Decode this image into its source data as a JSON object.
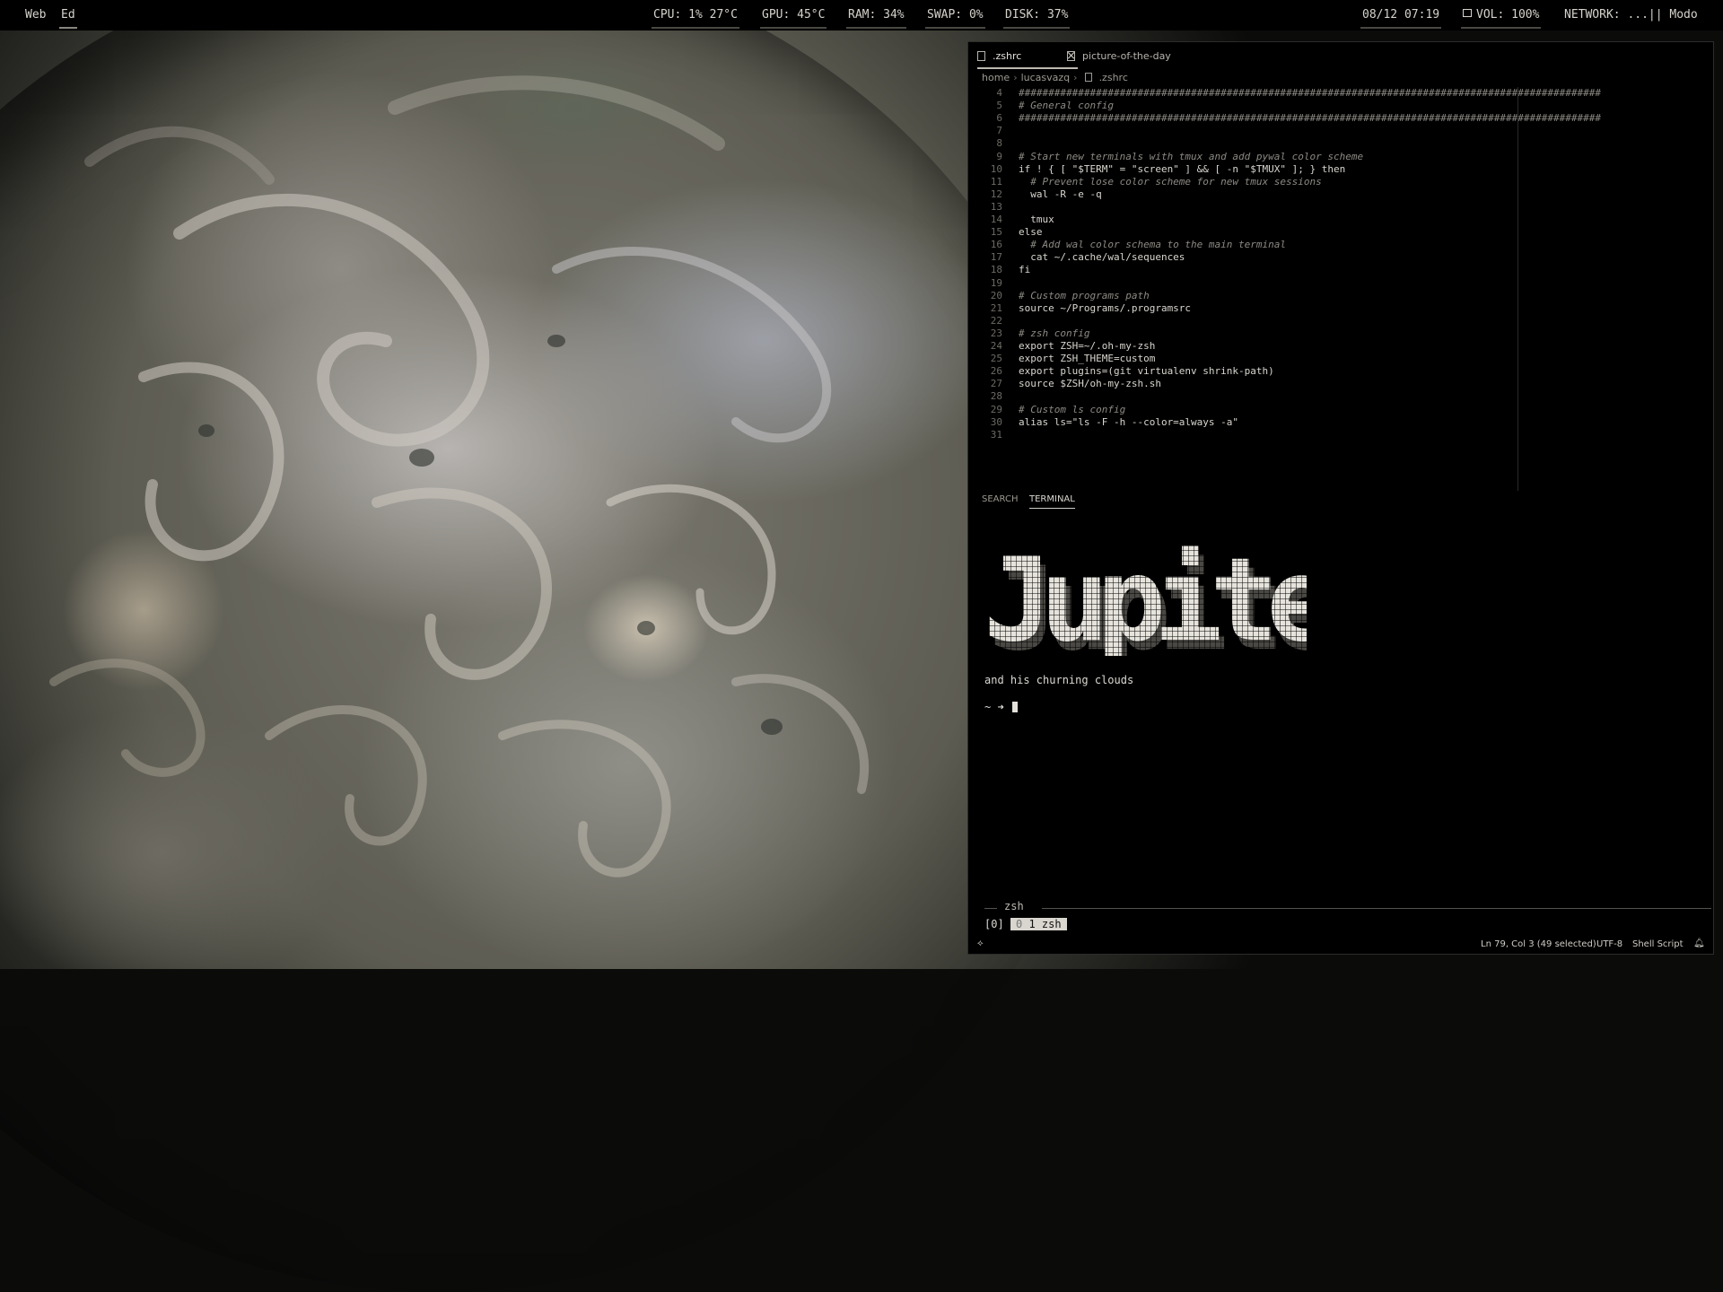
{
  "topbar": {
    "workspaces": [
      {
        "label": "Web",
        "active": false
      },
      {
        "label": "Ed",
        "active": true
      }
    ],
    "cpu": "CPU: 1% 27°C",
    "gpu": "GPU: 45°C",
    "ram": "RAM: 34%",
    "swap": "SWAP: 0%",
    "disk": "DISK: 37%",
    "datetime": "08/12 07:19",
    "volume": "VOL: 100%",
    "network": "NETWORK: ...|| Modo"
  },
  "editor": {
    "tabs": [
      {
        "label": ".zshrc",
        "active": true
      },
      {
        "label": "picture-of-the-day",
        "active": false
      }
    ],
    "breadcrumb": [
      "home",
      "lucasvazq",
      ".zshrc"
    ],
    "code_lines": [
      {
        "n": "4",
        "text": "##################################################################################################",
        "kind": "hash"
      },
      {
        "n": "5",
        "text": "# General config",
        "kind": "comment"
      },
      {
        "n": "6",
        "text": "##################################################################################################",
        "kind": "hash"
      },
      {
        "n": "7",
        "text": "",
        "kind": "code"
      },
      {
        "n": "8",
        "text": "",
        "kind": "code"
      },
      {
        "n": "9",
        "text": "# Start new terminals with tmux and add pywal color scheme",
        "kind": "comment"
      },
      {
        "n": "10",
        "text": "if ! { [ \"$TERM\" = \"screen\" ] && [ -n \"$TMUX\" ]; } then",
        "kind": "code"
      },
      {
        "n": "11",
        "text": "  # Prevent lose color scheme for new tmux sessions",
        "kind": "comment"
      },
      {
        "n": "12",
        "text": "  wal -R -e -q",
        "kind": "code"
      },
      {
        "n": "13",
        "text": "",
        "kind": "code"
      },
      {
        "n": "14",
        "text": "  tmux",
        "kind": "code"
      },
      {
        "n": "15",
        "text": "else",
        "kind": "code"
      },
      {
        "n": "16",
        "text": "  # Add wal color schema to the main terminal",
        "kind": "comment"
      },
      {
        "n": "17",
        "text": "  cat ~/.cache/wal/sequences",
        "kind": "code"
      },
      {
        "n": "18",
        "text": "fi",
        "kind": "code"
      },
      {
        "n": "19",
        "text": "",
        "kind": "code"
      },
      {
        "n": "20",
        "text": "# Custom programs path",
        "kind": "comment"
      },
      {
        "n": "21",
        "text": "source ~/Programs/.programsrc",
        "kind": "code"
      },
      {
        "n": "22",
        "text": "",
        "kind": "code"
      },
      {
        "n": "23",
        "text": "# zsh config",
        "kind": "comment"
      },
      {
        "n": "24",
        "text": "export ZSH=~/.oh-my-zsh",
        "kind": "code"
      },
      {
        "n": "25",
        "text": "export ZSH_THEME=custom",
        "kind": "code"
      },
      {
        "n": "26",
        "text": "export plugins=(git virtualenv shrink-path)",
        "kind": "code"
      },
      {
        "n": "27",
        "text": "source $ZSH/oh-my-zsh.sh",
        "kind": "code"
      },
      {
        "n": "28",
        "text": "",
        "kind": "code"
      },
      {
        "n": "29",
        "text": "# Custom ls config",
        "kind": "comment"
      },
      {
        "n": "30",
        "text": "alias ls=\"ls -F -h --color=always -a\"",
        "kind": "code"
      },
      {
        "n": "31",
        "text": "",
        "kind": "code"
      }
    ],
    "panel_tabs": {
      "search": "SEARCH",
      "terminal": "TERMINAL"
    },
    "terminal": {
      "banner": "Jupiter",
      "subtitle": "and his churning clouds",
      "prompt": "~ ➜",
      "tmux_label": "zsh",
      "tmux_session": "[0]",
      "tmux_window_index": "0",
      "tmux_window": "1 zsh"
    },
    "status": {
      "branch_icon": "source-control-icon",
      "position": "Ln 79, Col 3 (49 selected)",
      "encoding": "UTF-8",
      "language": "Shell Script",
      "bell_icon": "bell-icon"
    }
  }
}
